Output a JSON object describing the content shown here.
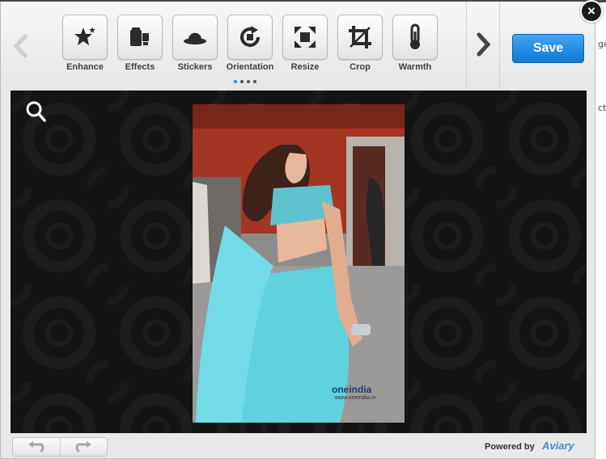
{
  "toolbar": {
    "tools": [
      {
        "label": "Enhance",
        "icon": "magic-stars-icon"
      },
      {
        "label": "Effects",
        "icon": "film-effects-icon"
      },
      {
        "label": "Stickers",
        "icon": "bowler-hat-icon"
      },
      {
        "label": "Orientation",
        "icon": "rotate-icon"
      },
      {
        "label": "Resize",
        "icon": "resize-arrows-icon"
      },
      {
        "label": "Crop",
        "icon": "crop-icon"
      },
      {
        "label": "Warmth",
        "icon": "thermometer-icon"
      }
    ],
    "page_indicator": {
      "pages": 4,
      "active": 1
    },
    "save_label": "Save",
    "close_label": "×"
  },
  "canvas": {
    "zoom_icon": "magnifier-icon",
    "photo": {
      "watermark_brand": "oneindia",
      "watermark_url": "www.oneindia.in"
    }
  },
  "footer": {
    "powered_label": "Powered by",
    "brand": "Aviary"
  },
  "page_edge_text": {
    "line1": "ge",
    "line2": "ct"
  },
  "colors": {
    "accent": "#1a86e0",
    "canvas_bg": "#141414",
    "toolbar_bg": "#ececec"
  }
}
